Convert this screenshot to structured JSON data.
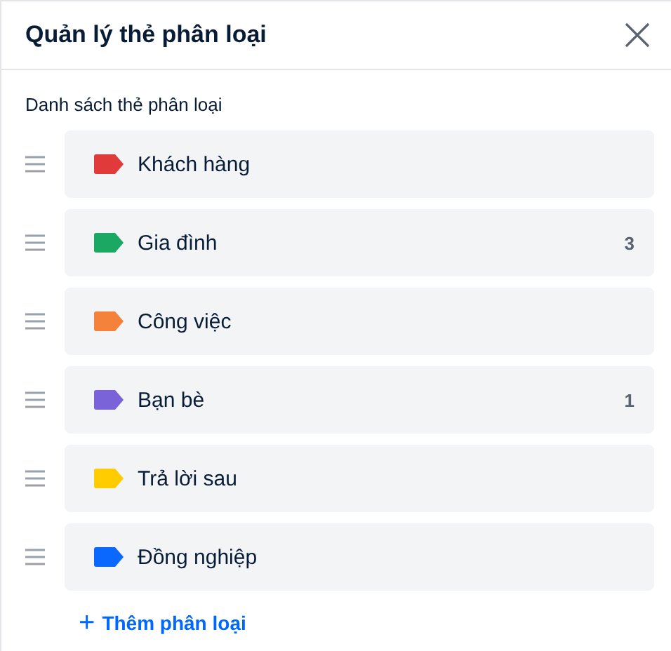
{
  "dialog": {
    "title": "Quản lý thẻ phân loại"
  },
  "section_label": "Danh sách thẻ phân loại",
  "tags": [
    {
      "name": "Khách hàng",
      "color": "#e03a3a"
    },
    {
      "name": "Gia đình",
      "color": "#1aa863",
      "count": "3"
    },
    {
      "name": "Công việc",
      "color": "#f5823a"
    },
    {
      "name": "Bạn bè",
      "color": "#7a63d8",
      "count": "1"
    },
    {
      "name": "Trả lời sau",
      "color": "#ffcc00"
    },
    {
      "name": "Đồng nghiệp",
      "color": "#0b68ff"
    }
  ],
  "add_link": {
    "icon": "+",
    "label": "Thêm phân loại"
  }
}
